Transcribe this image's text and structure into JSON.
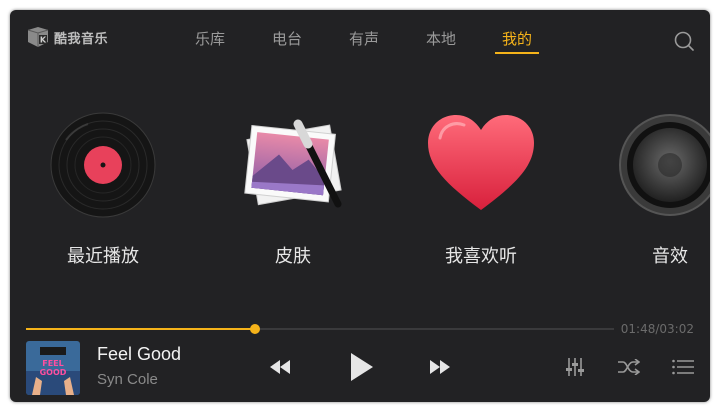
{
  "app": {
    "name": "酷我音乐",
    "logo_icon": "kuwo-logo-icon"
  },
  "nav": {
    "tabs": [
      {
        "label": "乐库",
        "active": false
      },
      {
        "label": "电台",
        "active": false
      },
      {
        "label": "有声",
        "active": false
      },
      {
        "label": "本地",
        "active": false
      },
      {
        "label": "我的",
        "active": true
      }
    ],
    "search_icon": "search-icon"
  },
  "tiles": [
    {
      "label": "最近播放",
      "icon": "vinyl-record-icon"
    },
    {
      "label": "皮肤",
      "icon": "skin-photo-brush-icon"
    },
    {
      "label": "我喜欢听",
      "icon": "heart-icon"
    },
    {
      "label": "音效",
      "icon": "speaker-icon"
    }
  ],
  "player": {
    "progress": 0.39,
    "time": "01:48/03:02",
    "song_title": "Feel Good",
    "artist": "Syn Cole",
    "album_art_text": "FEEL GOOD",
    "controls": [
      "previous-icon",
      "play-icon",
      "next-icon",
      "equalizer-icon",
      "shuffle-icon",
      "playlist-icon"
    ]
  },
  "colors": {
    "accent": "#f5b31a",
    "background": "#222224",
    "text": "#e6e6e6",
    "muted": "#9a9a9a"
  }
}
